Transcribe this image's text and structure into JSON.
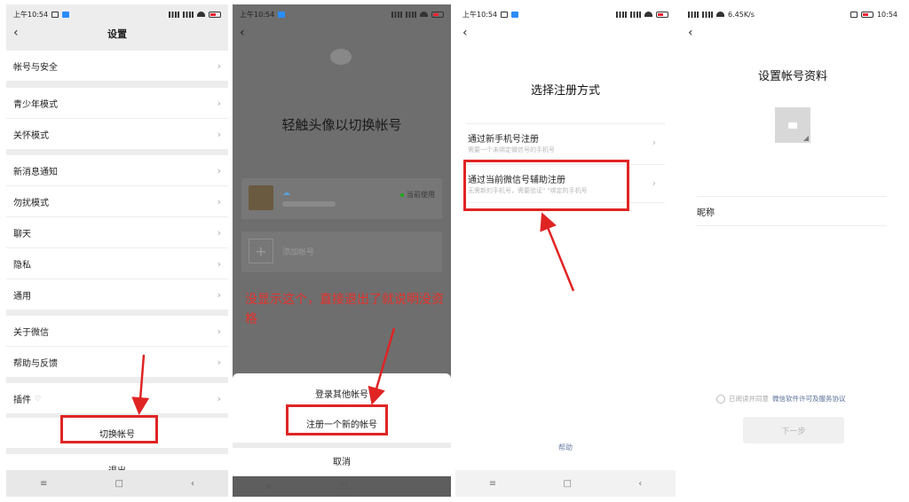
{
  "panel1": {
    "status_time": "上午10:54",
    "title": "设置",
    "items": [
      {
        "label": "帐号与安全"
      },
      {
        "label": "青少年模式"
      },
      {
        "label": "关怀模式"
      },
      {
        "label": "新消息通知"
      },
      {
        "label": "勿扰模式"
      },
      {
        "label": "聊天"
      },
      {
        "label": "隐私"
      },
      {
        "label": "通用"
      },
      {
        "label": "关于微信"
      },
      {
        "label": "帮助与反馈"
      },
      {
        "label": "插件"
      },
      {
        "label": "切换帐号"
      },
      {
        "label": "退出"
      }
    ],
    "nav": [
      "≡",
      "□",
      "‹"
    ]
  },
  "panel2": {
    "status_time": "上午10:54",
    "heading": "轻触头像以切换帐号",
    "current_account_badge": "当前使用",
    "add_account_label": "添加帐号",
    "annotation": "没显示这个，直接退出了就说明没资格",
    "sheet_items": [
      "登录其他帐号",
      "注册一个新的帐号",
      "取消"
    ]
  },
  "panel3": {
    "status_time": "上午10:54",
    "title": "选择注册方式",
    "options": [
      {
        "title": "通过新手机号注册",
        "subtitle": "需要一个未绑定微信号的手机号"
      },
      {
        "title": "通过当前微信号辅助注册",
        "subtitle": "无需新的手机号，需要验证\"          \"绑定的手机号"
      }
    ],
    "help": "帮助",
    "nav": [
      "≡",
      "□",
      "‹"
    ]
  },
  "panel4": {
    "status_speed": "6.45K/s",
    "status_time": "10:54",
    "title": "设置帐号资料",
    "nickname_label": "昵称",
    "agree_text": "已阅读并同意",
    "agree_link": "微信软件许可及服务协议",
    "next_button": "下一步"
  },
  "colors": {
    "annotation_red": "#e02424",
    "wechat_green": "#1aad19",
    "link_blue": "#5a6f98"
  }
}
